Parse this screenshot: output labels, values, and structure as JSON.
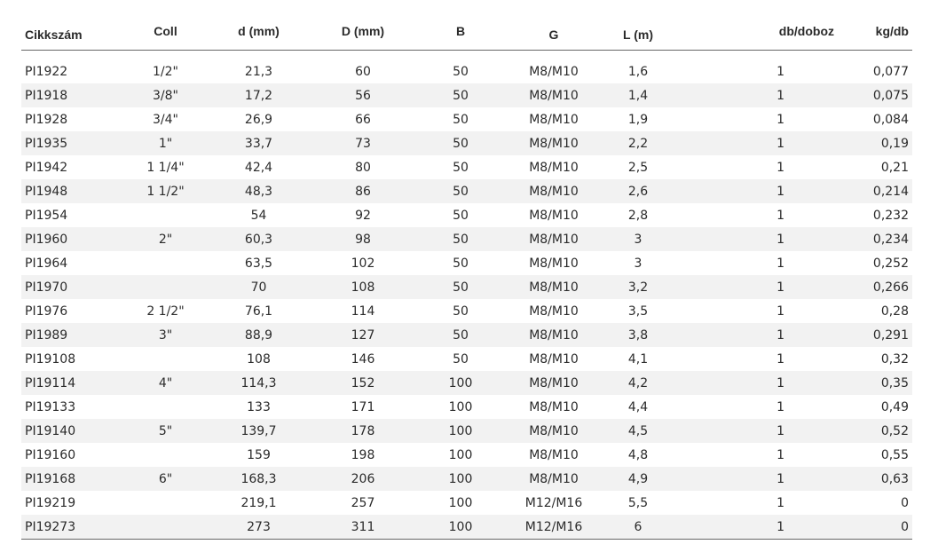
{
  "table": {
    "headers": {
      "cikkszam": "Cikkszám",
      "coll": "Coll",
      "d": "d (mm)",
      "D": "D (mm)",
      "B": "B",
      "G": "G",
      "L": "L (m)",
      "db": "db/doboz",
      "kg": "kg/db"
    },
    "rows": [
      {
        "cikkszam": "PI1922",
        "coll": "1/2\"",
        "d": "21,3",
        "D": "60",
        "B": "50",
        "G": "M8/M10",
        "L": "1,6",
        "db": "1",
        "kg": "0,077"
      },
      {
        "cikkszam": "PI1918",
        "coll": "3/8\"",
        "d": "17,2",
        "D": "56",
        "B": "50",
        "G": "M8/M10",
        "L": "1,4",
        "db": "1",
        "kg": "0,075"
      },
      {
        "cikkszam": "PI1928",
        "coll": "3/4\"",
        "d": "26,9",
        "D": "66",
        "B": "50",
        "G": "M8/M10",
        "L": "1,9",
        "db": "1",
        "kg": "0,084"
      },
      {
        "cikkszam": "PI1935",
        "coll": "1\"",
        "d": "33,7",
        "D": "73",
        "B": "50",
        "G": "M8/M10",
        "L": "2,2",
        "db": "1",
        "kg": "0,19"
      },
      {
        "cikkszam": "PI1942",
        "coll": "1 1/4\"",
        "d": "42,4",
        "D": "80",
        "B": "50",
        "G": "M8/M10",
        "L": "2,5",
        "db": "1",
        "kg": "0,21"
      },
      {
        "cikkszam": "PI1948",
        "coll": "1 1/2\"",
        "d": "48,3",
        "D": "86",
        "B": "50",
        "G": "M8/M10",
        "L": "2,6",
        "db": "1",
        "kg": "0,214"
      },
      {
        "cikkszam": "PI1954",
        "coll": "",
        "d": "54",
        "D": "92",
        "B": "50",
        "G": "M8/M10",
        "L": "2,8",
        "db": "1",
        "kg": "0,232"
      },
      {
        "cikkszam": "PI1960",
        "coll": "2\"",
        "d": "60,3",
        "D": "98",
        "B": "50",
        "G": "M8/M10",
        "L": "3",
        "db": "1",
        "kg": "0,234"
      },
      {
        "cikkszam": "PI1964",
        "coll": "",
        "d": "63,5",
        "D": "102",
        "B": "50",
        "G": "M8/M10",
        "L": "3",
        "db": "1",
        "kg": "0,252"
      },
      {
        "cikkszam": "PI1970",
        "coll": "",
        "d": "70",
        "D": "108",
        "B": "50",
        "G": "M8/M10",
        "L": "3,2",
        "db": "1",
        "kg": "0,266"
      },
      {
        "cikkszam": "PI1976",
        "coll": "2 1/2\"",
        "d": "76,1",
        "D": "114",
        "B": "50",
        "G": "M8/M10",
        "L": "3,5",
        "db": "1",
        "kg": "0,28"
      },
      {
        "cikkszam": "PI1989",
        "coll": "3\"",
        "d": "88,9",
        "D": "127",
        "B": "50",
        "G": "M8/M10",
        "L": "3,8",
        "db": "1",
        "kg": "0,291"
      },
      {
        "cikkszam": "PI19108",
        "coll": "",
        "d": "108",
        "D": "146",
        "B": "50",
        "G": "M8/M10",
        "L": "4,1",
        "db": "1",
        "kg": "0,32"
      },
      {
        "cikkszam": "PI19114",
        "coll": "4\"",
        "d": "114,3",
        "D": "152",
        "B": "100",
        "G": "M8/M10",
        "L": "4,2",
        "db": "1",
        "kg": "0,35"
      },
      {
        "cikkszam": "PI19133",
        "coll": "",
        "d": "133",
        "D": "171",
        "B": "100",
        "G": "M8/M10",
        "L": "4,4",
        "db": "1",
        "kg": "0,49"
      },
      {
        "cikkszam": "PI19140",
        "coll": "5\"",
        "d": "139,7",
        "D": "178",
        "B": "100",
        "G": "M8/M10",
        "L": "4,5",
        "db": "1",
        "kg": "0,52"
      },
      {
        "cikkszam": "PI19160",
        "coll": "",
        "d": "159",
        "D": "198",
        "B": "100",
        "G": "M8/M10",
        "L": "4,8",
        "db": "1",
        "kg": "0,55"
      },
      {
        "cikkszam": "PI19168",
        "coll": "6\"",
        "d": "168,3",
        "D": "206",
        "B": "100",
        "G": "M8/M10",
        "L": "4,9",
        "db": "1",
        "kg": "0,63"
      },
      {
        "cikkszam": "PI19219",
        "coll": "",
        "d": "219,1",
        "D": "257",
        "B": "100",
        "G": "M12/M16",
        "L": "5,5",
        "db": "1",
        "kg": "0"
      },
      {
        "cikkszam": "PI19273",
        "coll": "",
        "d": "273",
        "D": "311",
        "B": "100",
        "G": "M12/M16",
        "L": "6",
        "db": "1",
        "kg": "0"
      }
    ]
  }
}
